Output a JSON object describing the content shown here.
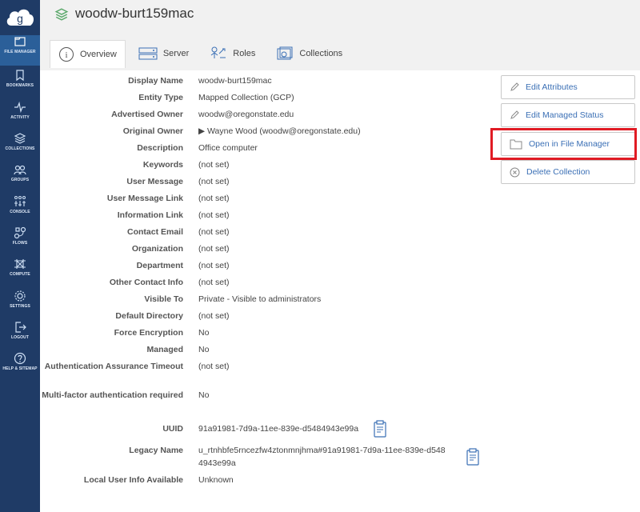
{
  "app": {
    "logo_letter": "g"
  },
  "sidebar": {
    "items": [
      {
        "label": "FILE MANAGER",
        "icon": "file-manager-icon"
      },
      {
        "label": "BOOKMARKS",
        "icon": "bookmark-icon"
      },
      {
        "label": "ACTIVITY",
        "icon": "activity-icon"
      },
      {
        "label": "COLLECTIONS",
        "icon": "collections-icon"
      },
      {
        "label": "GROUPS",
        "icon": "groups-icon"
      },
      {
        "label": "CONSOLE",
        "icon": "console-icon"
      },
      {
        "label": "FLOWS",
        "icon": "flows-icon"
      },
      {
        "label": "COMPUTE",
        "icon": "compute-icon"
      },
      {
        "label": "SETTINGS",
        "icon": "gear-icon"
      },
      {
        "label": "LOGOUT",
        "icon": "logout-icon"
      },
      {
        "label": "HELP & SITEMAP",
        "icon": "help-icon"
      }
    ]
  },
  "header": {
    "title": "woodw-burt159mac",
    "tabs": [
      {
        "label": "Overview",
        "icon": "info-icon"
      },
      {
        "label": "Server",
        "icon": "server-icon"
      },
      {
        "label": "Roles",
        "icon": "roles-icon"
      },
      {
        "label": "Collections",
        "icon": "collections-icon"
      }
    ]
  },
  "details": [
    {
      "key": "Display Name",
      "value": "woodw-burt159mac"
    },
    {
      "key": "Entity Type",
      "value": "Mapped Collection (GCP)"
    },
    {
      "key": "Advertised Owner",
      "value": "woodw@oregonstate.edu"
    },
    {
      "key": "Original Owner",
      "value": "▶ Wayne Wood (woodw@oregonstate.edu)"
    },
    {
      "key": "Description",
      "value": "Office computer"
    },
    {
      "key": "Keywords",
      "value": "(not set)"
    },
    {
      "key": "User Message",
      "value": "(not set)"
    },
    {
      "key": "User Message Link",
      "value": "(not set)"
    },
    {
      "key": "Information Link",
      "value": "(not set)"
    },
    {
      "key": "Contact Email",
      "value": "(not set)"
    },
    {
      "key": "Organization",
      "value": "(not set)"
    },
    {
      "key": "Department",
      "value": "(not set)"
    },
    {
      "key": "Other Contact Info",
      "value": "(not set)"
    },
    {
      "key": "Visible To",
      "value": "Private - Visible to administrators"
    },
    {
      "key": "Default Directory",
      "value": "(not set)"
    },
    {
      "key": "Force Encryption",
      "value": "No"
    },
    {
      "key": "Managed",
      "value": "No"
    },
    {
      "key": "Authentication Assurance Timeout",
      "value": "(not set)"
    },
    {
      "key": "Multi-factor authentication required",
      "value": "No"
    },
    {
      "key": "UUID",
      "value": "91a91981-7d9a-11ee-839e-d5484943e99a"
    },
    {
      "key": "Legacy Name",
      "value": "u_rtnhbfe5rncezfw4ztonmnjhma#91a91981-7d9a-11ee-839e-d5484943e99a"
    },
    {
      "key": "Local User Info Available",
      "value": "Unknown"
    }
  ],
  "actions": {
    "edit_attributes": "Edit Attributes",
    "edit_managed_status": "Edit Managed Status",
    "open_in_file_manager": "Open in File Manager",
    "delete_collection": "Delete Collection"
  },
  "colors": {
    "sidebar": "#1f3b66",
    "sidebar_active": "#2b5f99",
    "link": "#3a6fb5",
    "highlight": "#e01b24",
    "header_bg": "#f1f1f1"
  }
}
